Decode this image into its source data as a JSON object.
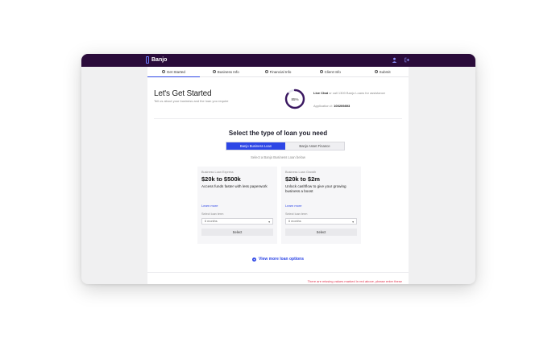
{
  "app": {
    "brand": "Banjo"
  },
  "topbar": {
    "icons": [
      "user-icon",
      "sign-out-icon"
    ]
  },
  "tabs": [
    {
      "label": "Get Started",
      "active": true
    },
    {
      "label": "Business Info",
      "active": false
    },
    {
      "label": "Financial Info",
      "active": false
    },
    {
      "label": "Client Info",
      "active": false
    },
    {
      "label": "Submit",
      "active": false
    }
  ],
  "header": {
    "title": "Let's Get Started",
    "subtitle": "Tell us about your business and the loan you require"
  },
  "progress": {
    "percent": 0.85,
    "label": "85%"
  },
  "live": {
    "lead": "Live Chat",
    "text": "or call 1300 Banjo Loans for assistance"
  },
  "application": {
    "label": "Application #:",
    "id": "100209893"
  },
  "loan_type": {
    "title": "Select the type of loan you need",
    "options": [
      "Banjo Business Loan",
      "Banjo Asset Finance"
    ],
    "selected": 0,
    "hint": "Select a Banjo Business Loan below"
  },
  "loans": [
    {
      "kicker": "Business Loan Express",
      "amount": "$20k to $500k",
      "description": "Access funds faster with less paperwork",
      "learn_more": "Learn more",
      "select_label": "Select loan term",
      "select_value": "6 months",
      "button": "Select"
    },
    {
      "kicker": "Business Loan Growth",
      "amount": "$20k to $2m",
      "description": "Unlock cashflow to give your growing business a boost",
      "learn_more": "Learn more",
      "select_label": "Select loan term",
      "select_value": "6 months",
      "button": "Select"
    }
  ],
  "more_options": "View more loan options",
  "warning": "There are missing values marked in red above, please enter these",
  "colors": {
    "topbar": "#2a0b3a",
    "accent": "#2d46e6",
    "warning": "#e0334d"
  }
}
